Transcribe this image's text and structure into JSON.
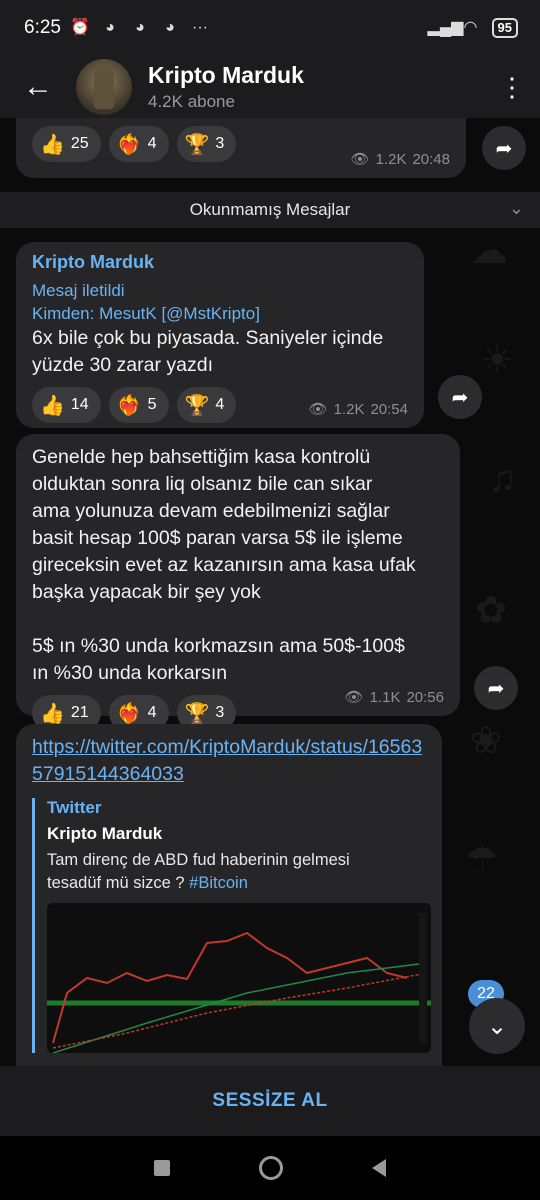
{
  "status_bar": {
    "time": "6:25",
    "battery": "95",
    "icons": [
      "alarm-icon",
      "discord-icon",
      "discord-icon",
      "discord-icon",
      "more-icon"
    ],
    "signal_icons": [
      "signal-icon",
      "wifi-icon",
      "battery-icon"
    ]
  },
  "header": {
    "title": "Kripto Marduk",
    "subtitle": "4.2K abone",
    "back_icon": "arrow-left-icon",
    "menu_icon": "more-vertical-icon"
  },
  "top_message": {
    "reactions": [
      {
        "emoji": "👍",
        "count": "25"
      },
      {
        "emoji": "❤️‍🔥",
        "count": "4"
      },
      {
        "emoji": "🏆",
        "count": "3"
      }
    ],
    "views": "1.2K",
    "time": "20:48"
  },
  "unread_divider": "Okunmamış Mesajlar",
  "messages": [
    {
      "sender": "Kripto Marduk",
      "forwarded": "Mesaj iletildi",
      "forwarded_from": "Kimden: MesutK [@MstKripto]",
      "text": "6x bile çok bu piyasada. Saniyeler içinde\nyüzde 30 zarar yazdı",
      "reactions": [
        {
          "emoji": "👍",
          "count": "14"
        },
        {
          "emoji": "❤️‍🔥",
          "count": "5"
        },
        {
          "emoji": "🏆",
          "count": "4"
        }
      ],
      "views": "1.2K",
      "time": "20:54"
    },
    {
      "text": "Genelde hep bahsettiğim kasa kontrolü\nolduktan sonra liq olsanız bile can sıkar\nama yolunuza devam edebilmenizi sağlar\nbasit hesap 100$ paran varsa 5$ ile işleme\ngireceksin evet az kazanırsın ama kasa ufak\nbaşka yapacak bir şey yok\n\n5$ ın %30 unda korkmazsın ama 50$-100$\nın %30 unda korkarsın",
      "reactions": [
        {
          "emoji": "👍",
          "count": "21"
        },
        {
          "emoji": "❤️‍🔥",
          "count": "4"
        },
        {
          "emoji": "🏆",
          "count": "3"
        }
      ],
      "views": "1.1K",
      "time": "20:56"
    },
    {
      "link": "https://twitter.com/KriptoMarduk/status/1656357915144364033",
      "preview_site": "Twitter",
      "preview_title": "Kripto Marduk",
      "preview_desc": "Tam direnç de ABD fud haberinin gelmesi\ntesadüf mü sizce ?",
      "preview_tag": "#Bitcoin"
    }
  ],
  "scroll_badge": "22",
  "bottom_action": "SESSİZE AL"
}
